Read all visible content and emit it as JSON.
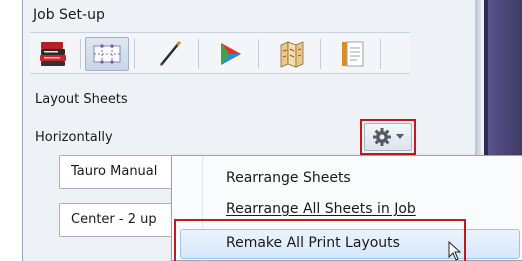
{
  "panel": {
    "title": "Job Set-up"
  },
  "toolbar": {
    "items": [
      {
        "icon": "books-icon",
        "active": false
      },
      {
        "icon": "grid-layout-icon",
        "active": true
      },
      {
        "icon": "pen-icon",
        "active": false
      },
      {
        "icon": "color-wheel-icon",
        "active": false
      },
      {
        "icon": "folding-map-icon",
        "active": false
      },
      {
        "icon": "document-page-icon",
        "active": false
      }
    ]
  },
  "layout_sheets": {
    "section_label": "Layout Sheets",
    "row_label": "Horizontally",
    "gear_button_icon": "gear-icon",
    "dropdown_1_value": "Tauro Manual",
    "dropdown_2_value": "Center - 2 up"
  },
  "context_menu": {
    "items": [
      {
        "label": "Rearrange Sheets"
      },
      {
        "label": "Rearrange All Sheets in Job"
      },
      {
        "label": "Remake All Print Layouts"
      }
    ]
  },
  "colors": {
    "highlight_border": "#c0191f",
    "side_band": "#4a4678",
    "hover_fill": "#d7e8fb"
  }
}
